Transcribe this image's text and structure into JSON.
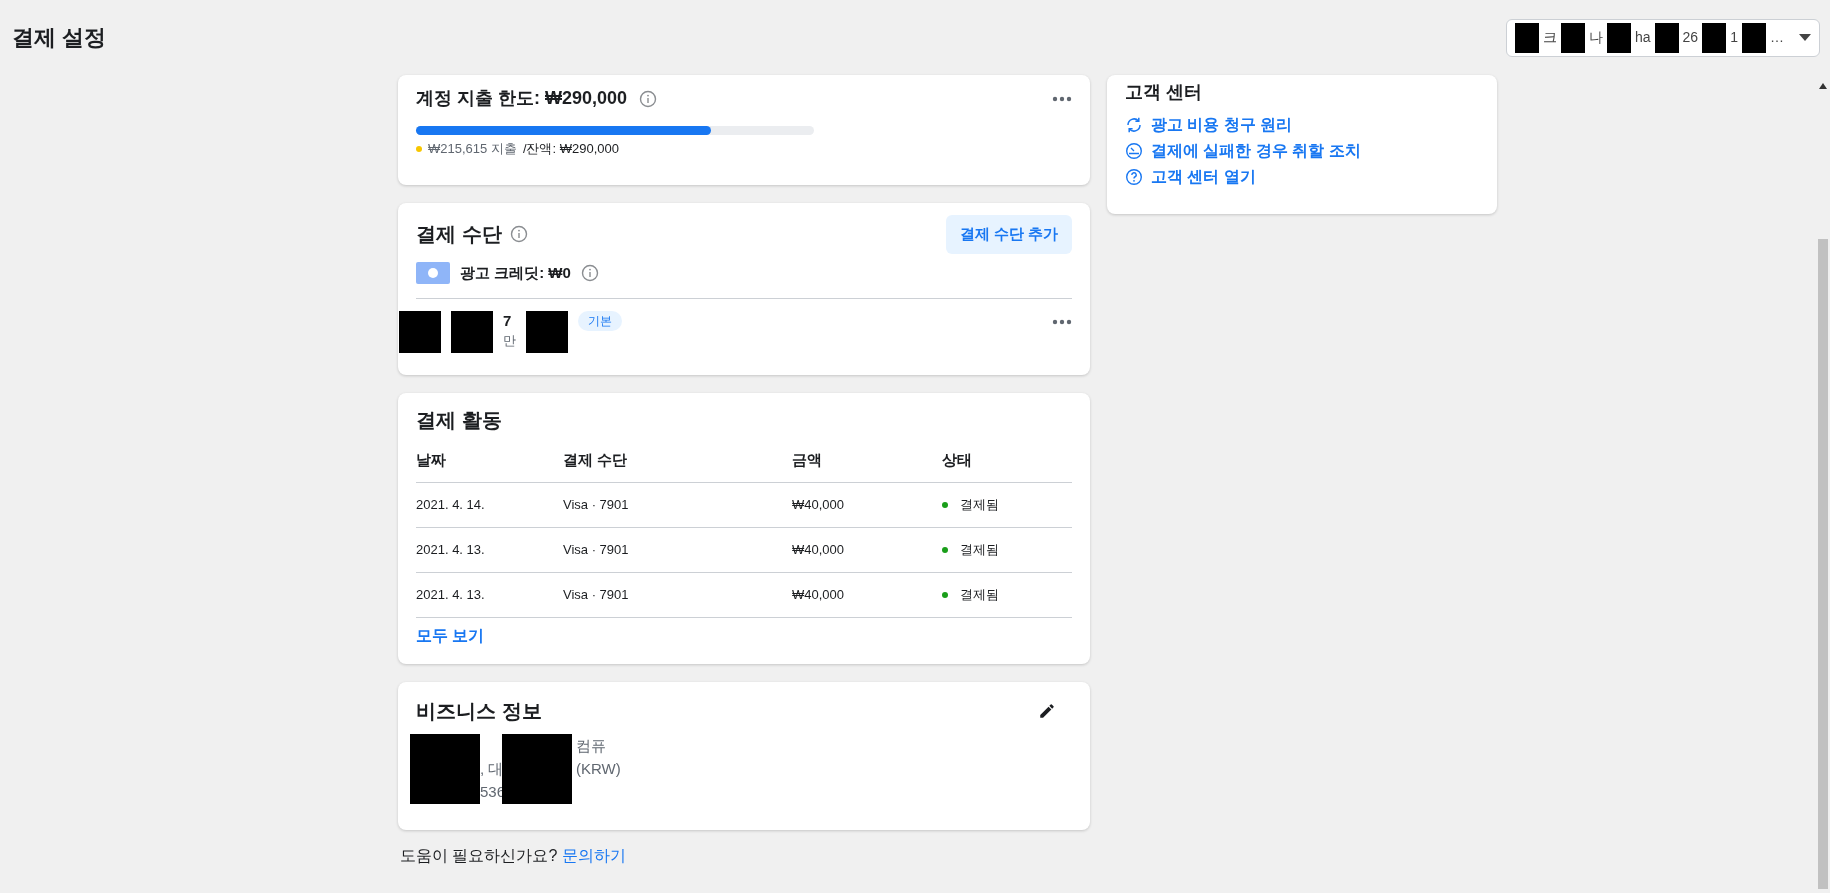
{
  "header": {
    "title": "결제 설정",
    "account_select": {
      "fragments": [
        "크",
        "나",
        "ha",
        "26",
        "1",
        "…"
      ]
    }
  },
  "spending_limit": {
    "title": "계정 지출 한도: ",
    "amount": "₩290,000",
    "level": 0.74,
    "spent": "₩215,615 지출",
    "remaining": "/잔액: ₩290,000",
    "color": "#f7c600"
  },
  "payment_methods": {
    "title": "결제 수단",
    "add_button": "결제 수단 추가",
    "ad_credit_label": "광고 크레딧: ",
    "ad_credit_amount": "₩0",
    "card": {
      "number_fragment": "7",
      "sub_fragment": "만",
      "badge": "기본"
    }
  },
  "payment_activity": {
    "title": "결제 활동",
    "columns": [
      "날짜",
      "결제 수단",
      "금액",
      "상태"
    ],
    "rows": [
      {
        "date": "2021. 4. 14.",
        "method": "Visa · 7901",
        "amount": "₩40,000",
        "status": "결제됨",
        "color": "#1a9e1a"
      },
      {
        "date": "2021. 4. 13.",
        "method": "Visa · 7901",
        "amount": "₩40,000",
        "status": "결제됨",
        "color": "#1a9e1a"
      },
      {
        "date": "2021. 4. 13.",
        "method": "Visa · 7901",
        "amount": "₩40,000",
        "status": "결제됨",
        "color": "#1a9e1a"
      }
    ],
    "see_all": "모두 보기"
  },
  "business_info": {
    "title": "비즈니스 정보",
    "lines": [
      {
        "after": "컴퓨"
      },
      {
        "before": ", 대",
        "after": "(KRW)"
      },
      {
        "before": "536"
      }
    ]
  },
  "help_footer": {
    "text": "도움이 필요하신가요? ",
    "link": "문의하기"
  },
  "help_center": {
    "title": "고객 센터",
    "links": [
      {
        "kind": "billing",
        "label": "광고 비용 청구 원리"
      },
      {
        "kind": "failed",
        "label": "결제에 실패한 경우 취할 조치"
      },
      {
        "kind": "help",
        "label": "고객 센터 열기"
      }
    ]
  }
}
